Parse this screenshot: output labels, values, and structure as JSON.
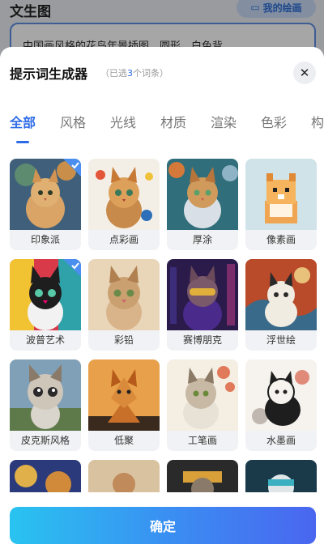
{
  "background": {
    "title": "文生图",
    "my_art_button": "我的绘画",
    "prompt_text": "中国画风格的花鸟年景插图，圆形，白色背"
  },
  "sheet": {
    "title": "提示词生成器",
    "subtitle_prefix": "（已选",
    "selected_count": "3",
    "subtitle_suffix": "个词条）",
    "close_icon": "close-icon"
  },
  "tabs": [
    {
      "label": "全部",
      "active": true
    },
    {
      "label": "风格",
      "active": false
    },
    {
      "label": "光线",
      "active": false
    },
    {
      "label": "材质",
      "active": false
    },
    {
      "label": "渲染",
      "active": false
    },
    {
      "label": "色彩",
      "active": false
    },
    {
      "label": "构",
      "active": false
    }
  ],
  "styles": [
    {
      "label": "印象派",
      "selected": true
    },
    {
      "label": "点彩画",
      "selected": false
    },
    {
      "label": "厚涂",
      "selected": false
    },
    {
      "label": "像素画",
      "selected": false
    },
    {
      "label": "波普艺术",
      "selected": true
    },
    {
      "label": "彩铅",
      "selected": false
    },
    {
      "label": "赛博朋克",
      "selected": false
    },
    {
      "label": "浮世绘",
      "selected": false
    },
    {
      "label": "皮克斯风格",
      "selected": false
    },
    {
      "label": "低聚",
      "selected": false
    },
    {
      "label": "工笔画",
      "selected": false
    },
    {
      "label": "水墨画",
      "selected": false
    }
  ],
  "confirm_label": "确定",
  "colors": {
    "accent": "#2e6be6",
    "check": "#4a8ff0"
  }
}
